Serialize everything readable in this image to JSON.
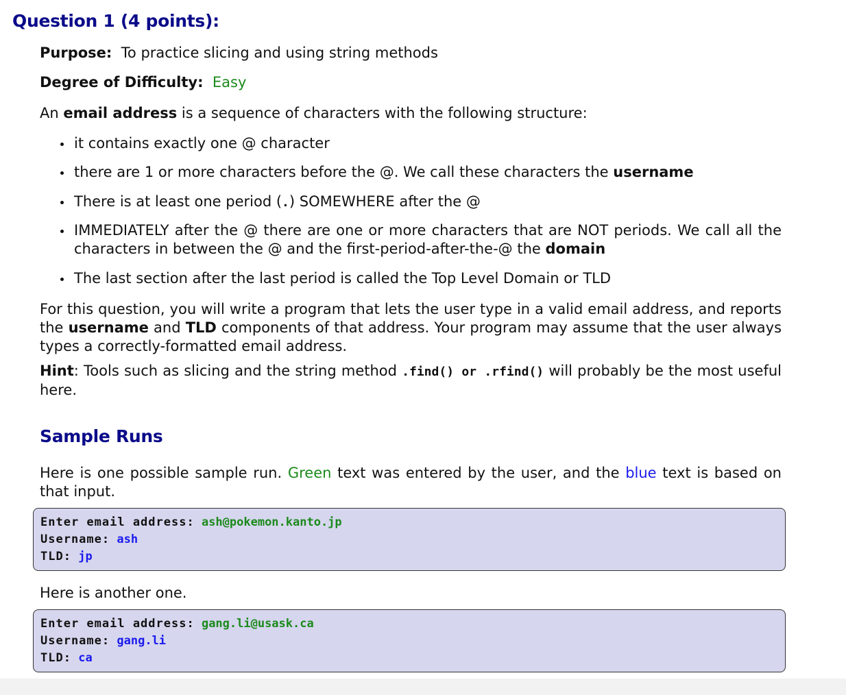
{
  "question": {
    "title": "Question 1 (4 points):"
  },
  "purpose": {
    "label": "Purpose:",
    "text": "To practice slicing and using string methods"
  },
  "difficulty": {
    "label": "Degree of Difficulty:",
    "value": "Easy"
  },
  "intro": {
    "prefix": "An ",
    "bold": "email address",
    "suffix": " is a sequence of characters with the following structure:"
  },
  "bullets": [
    {
      "text": "it contains exactly one @ character"
    },
    {
      "text": "there are 1 or more characters before the @. We call these characters the ",
      "bold": "username"
    },
    {
      "text_before_code": "There is at least one period (",
      "code": ".",
      "text_after_code": ") SOMEWHERE after the @"
    },
    {
      "text": "IMMEDIATELY after the @ there are one or more characters that are NOT periods.  We call all the characters in between the @ and the first-period-after-the-@ the ",
      "bold": "domain"
    },
    {
      "text": "The last section after the last period is called the Top Level Domain or TLD"
    }
  ],
  "main_paragraph": {
    "part1": "For this question, you will write a program that lets the user type in a valid email address, and reports the ",
    "bold1": "username",
    "part2": " and ",
    "bold2": "TLD",
    "part3": " components of that address. Your program may assume that the user always types a correctly-formatted email address."
  },
  "hint": {
    "label": "Hint",
    "part1": ": Tools such as slicing and the string method ",
    "code1": ".find()",
    "or": " or ",
    "code2": ".rfind()",
    "part2": " will probably be the most useful here."
  },
  "sample_runs": {
    "title": "Sample Runs",
    "intro_part1": "Here is one possible sample run. ",
    "green_word": "Green",
    "intro_part2": " text was entered by the user, and the ",
    "blue_word": "blue",
    "intro_part3": " text is based on that input.",
    "another": "Here is another one.",
    "runs": [
      {
        "enter_label": "Enter email address:",
        "enter_value": "ash@pokemon.kanto.jp",
        "username_label": "Username:",
        "username_value": "ash",
        "tld_label": "TLD:",
        "tld_value": "jp"
      },
      {
        "enter_label": "Enter email address:",
        "enter_value": "gang.li@usask.ca",
        "username_label": "Username:",
        "username_value": "gang.li",
        "tld_label": "TLD:",
        "tld_value": "ca"
      }
    ]
  },
  "colors": {
    "heading": "#0b0b8a",
    "user_input": "#1c8a1c",
    "program_output": "#1a1aee",
    "codebox_bg": "#d6d6ee"
  }
}
